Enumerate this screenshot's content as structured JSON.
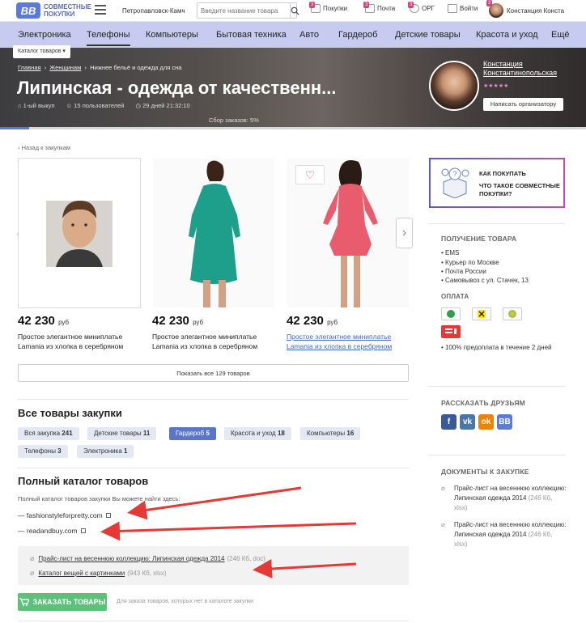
{
  "header": {
    "logo_mark": "ВВ",
    "logo_line1": "СОВМЕСТНЫЕ",
    "logo_line2": "ПОКУПКИ",
    "city": "Петропавловск-Камч",
    "search_placeholder": "Введите название товара",
    "links": [
      {
        "label": "Покупки",
        "badge": "3"
      },
      {
        "label": "Почта",
        "badge": "3"
      },
      {
        "label": "ОРГ",
        "badge": "3"
      },
      {
        "label": "Войти",
        "badge": ""
      }
    ],
    "user_badge": "3",
    "user_name": "Констанция Конста"
  },
  "nav": [
    "Электроника",
    "Телефоны",
    "Компьютеры",
    "Бытовая техника",
    "Авто",
    "Гардероб",
    "Детские товары",
    "Красота и уход",
    "Ещё"
  ],
  "hero": {
    "catalog_button": "Каталог товаров",
    "breadcrumbs": [
      "Главная",
      "Женщинам",
      "Нижнее бельё и одежда для сна"
    ],
    "title": "Липинская - одежда от качественн...",
    "meta": [
      "1-ый выкуп",
      "15 пользователей",
      "29 дней 21:32:10"
    ],
    "progress_text": "Сбор заказов: 5%",
    "progress_percent": 5,
    "organizer_line1": "Констанция",
    "organizer_line2": "Константинопольская",
    "rating_stars": "★★★★★",
    "write_button": "Написать организатору"
  },
  "main": {
    "back_link": "‹ Назад к закупкам",
    "products": [
      {
        "price": "42 230",
        "currency": "руб",
        "desc": "Простое элегантное миниплатье Lamania из хлопка в серебряном",
        "image": "man-portrait"
      },
      {
        "price": "42 230",
        "currency": "руб",
        "desc": "Простое элегантное миниплатье Lamania из хлопка в серебряном",
        "image": "teal-dress"
      },
      {
        "price": "42 230",
        "currency": "руб",
        "desc": "Простое элегантное миниплатье Lamania из хлопка в серебряном",
        "image": "coral-dress"
      }
    ],
    "show_all": "Показать все 129 товаров",
    "all_goods_title": "Все товары закупки",
    "tags": [
      {
        "label": "Вся закупка",
        "count": "241",
        "active": false
      },
      {
        "label": "Детские товары",
        "count": "11",
        "active": false
      },
      {
        "label": "Гардероб",
        "count": "5",
        "active": true
      },
      {
        "label": "Красота и уход",
        "count": "18",
        "active": false
      },
      {
        "label": "Компьютеры",
        "count": "16",
        "active": false
      },
      {
        "label": "Телефоны",
        "count": "3",
        "active": false
      },
      {
        "label": "Электроника",
        "count": "1",
        "active": false
      }
    ],
    "catalog_title": "Полный каталог товаров",
    "catalog_intro": "Полный каталог товаров закупки Вы можете найти здесь:",
    "catalog_links": [
      "— fashionstyleforpretty.com",
      "— readandbuy.com"
    ],
    "files": [
      {
        "name": "Прайс-лист на весеннюю коллекцию: Липинская одежда 2014",
        "meta": "(246 Кб, doc)"
      },
      {
        "name": "Каталог вещей с картинками",
        "meta": "(943 Кб, xlsx)"
      }
    ],
    "order_button": "ЗАКАЗАТЬ ТОВАРЫ",
    "order_note": "Для заказа товаров, которых нет в каталоге закупки"
  },
  "sidebar": {
    "how_to_buy": "КАК ПОКУПАТЬ",
    "what_is": "ЧТО ТАКОЕ СОВМЕСТНЫЕ ПОКУПКИ?",
    "delivery_title": "ПОЛУЧЕНИЕ ТОВАРА",
    "delivery_items": [
      "EMS",
      "Курьер по Москве",
      "Почта России",
      "Самовывоз с ул. Стачек, 13"
    ],
    "payment_title": "ОПЛАТА",
    "payment_note": "100% предоплата в течение 2 дней",
    "share_title": "РАССКАЗАТЬ ДРУЗЬЯМ",
    "social": [
      {
        "label": "f",
        "color": "#3b5998"
      },
      {
        "label": "vk",
        "color": "#4a76a8"
      },
      {
        "label": "ok",
        "color": "#ee8208"
      },
      {
        "label": "ВВ",
        "color": "#5b7bd5"
      }
    ],
    "docs_title": "ДОКУМЕНТЫ К ЗАКУПКЕ",
    "docs": [
      {
        "name": "Прайс-лист на весеннюю коллекцию: Липинская одежда 2014",
        "meta": "(246 Кб, xlsx)"
      },
      {
        "name": "Прайс-лист на весеннюю коллекцию: Липинская одежда 2014",
        "meta": "(246 Кб, xlsx)"
      }
    ]
  },
  "colors": {
    "accent": "#5b76c9",
    "nav_bg": "#c7cbf0",
    "order_button": "#5cc27a",
    "annotation": "#e53935"
  }
}
